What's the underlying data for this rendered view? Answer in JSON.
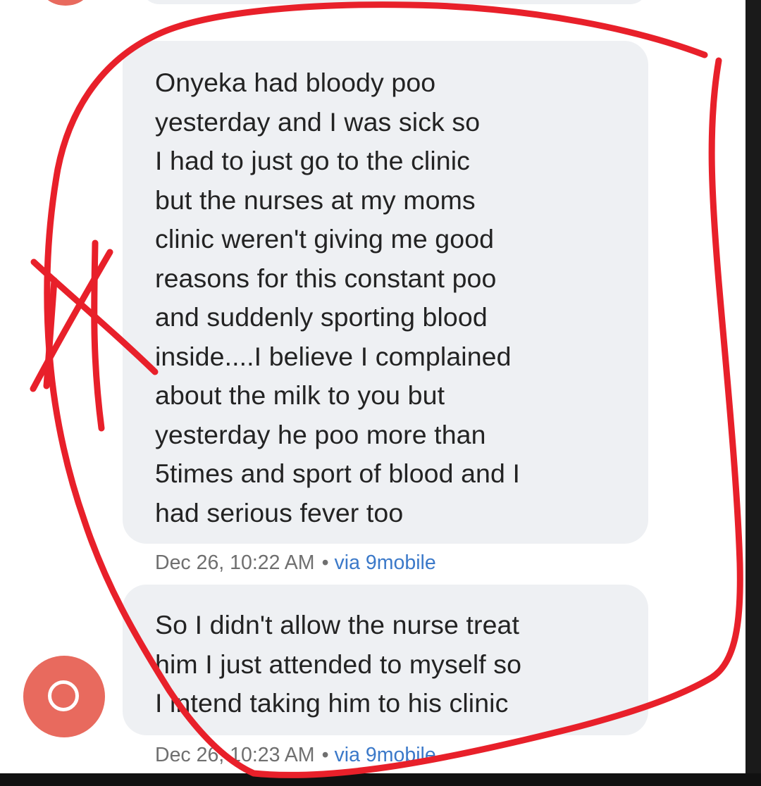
{
  "messages": [
    {
      "lines": [
        "Onyeka had bloody poo",
        "yesterday and I was sick so",
        "I had to just go to the clinic",
        "but the nurses at my moms",
        "clinic weren't giving me good",
        "reasons for this constant poo",
        "and suddenly sporting blood",
        "inside....I believe I complained",
        "about the milk to you but",
        "yesterday he poo more than",
        "5times and sport of blood and I",
        "had serious fever too"
      ],
      "timestamp": "Dec 26, 10:22 AM",
      "separator": "•",
      "carrier": "via 9mobile"
    },
    {
      "lines": [
        "So I didn't allow the nurse treat",
        "him I just attended to myself so",
        "I intend taking him to his clinic"
      ],
      "timestamp": "Dec 26, 10:23 AM",
      "separator": "•",
      "carrier": "via 9mobile"
    }
  ],
  "record_button": {
    "icon": "circle-icon",
    "color": "#e86a5e"
  },
  "annotation": {
    "color": "#e8202a",
    "shapes": [
      "freehand-loop",
      "x-mark"
    ]
  }
}
